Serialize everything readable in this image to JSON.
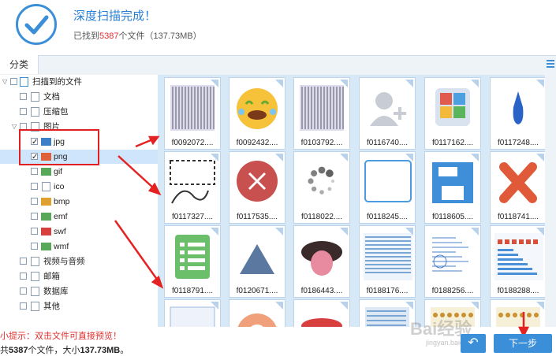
{
  "header": {
    "title": "深度扫描完成！",
    "found_prefix": "已找到",
    "found_count": "5387",
    "found_suffix": "个文件（137.73MB）"
  },
  "tabs": {
    "category": "分类"
  },
  "tree": {
    "root": "扫描到的文件",
    "documents": "文档",
    "archives": "压缩包",
    "images": "图片",
    "jpg": "jpg",
    "png": "png",
    "gif": "gif",
    "ico": "ico",
    "bmp": "bmp",
    "emf": "emf",
    "swf": "swf",
    "wmf": "wmf",
    "video": "视频与音频",
    "mail": "邮箱",
    "database": "数据库",
    "other": "其他"
  },
  "files": [
    "f0092072....",
    "f0092432....",
    "f0103792....",
    "f0116740....",
    "f0117162....",
    "f0117248....",
    "f0117327....",
    "f0117535....",
    "f0118022....",
    "f0118245....",
    "f0118605....",
    "f0118741....",
    "f0118791....",
    "f0120671....",
    "f0186443....",
    "f0188176....",
    "f0188256....",
    "f0188288...."
  ],
  "footer": {
    "hint": "小提示：双击文件可直接预览！",
    "total_prefix": "共",
    "total_count": "5387",
    "total_mid": "个文件，大小",
    "total_size": "137.73MB",
    "total_end": "。",
    "next": "下一步"
  },
  "watermark": {
    "line1": "Bai经验",
    "line2": "jingyan.baidu.com"
  },
  "colors": {
    "accent": "#3b8fd9",
    "highlight": "#e03030",
    "grid_bg": "#d7e8f7"
  }
}
